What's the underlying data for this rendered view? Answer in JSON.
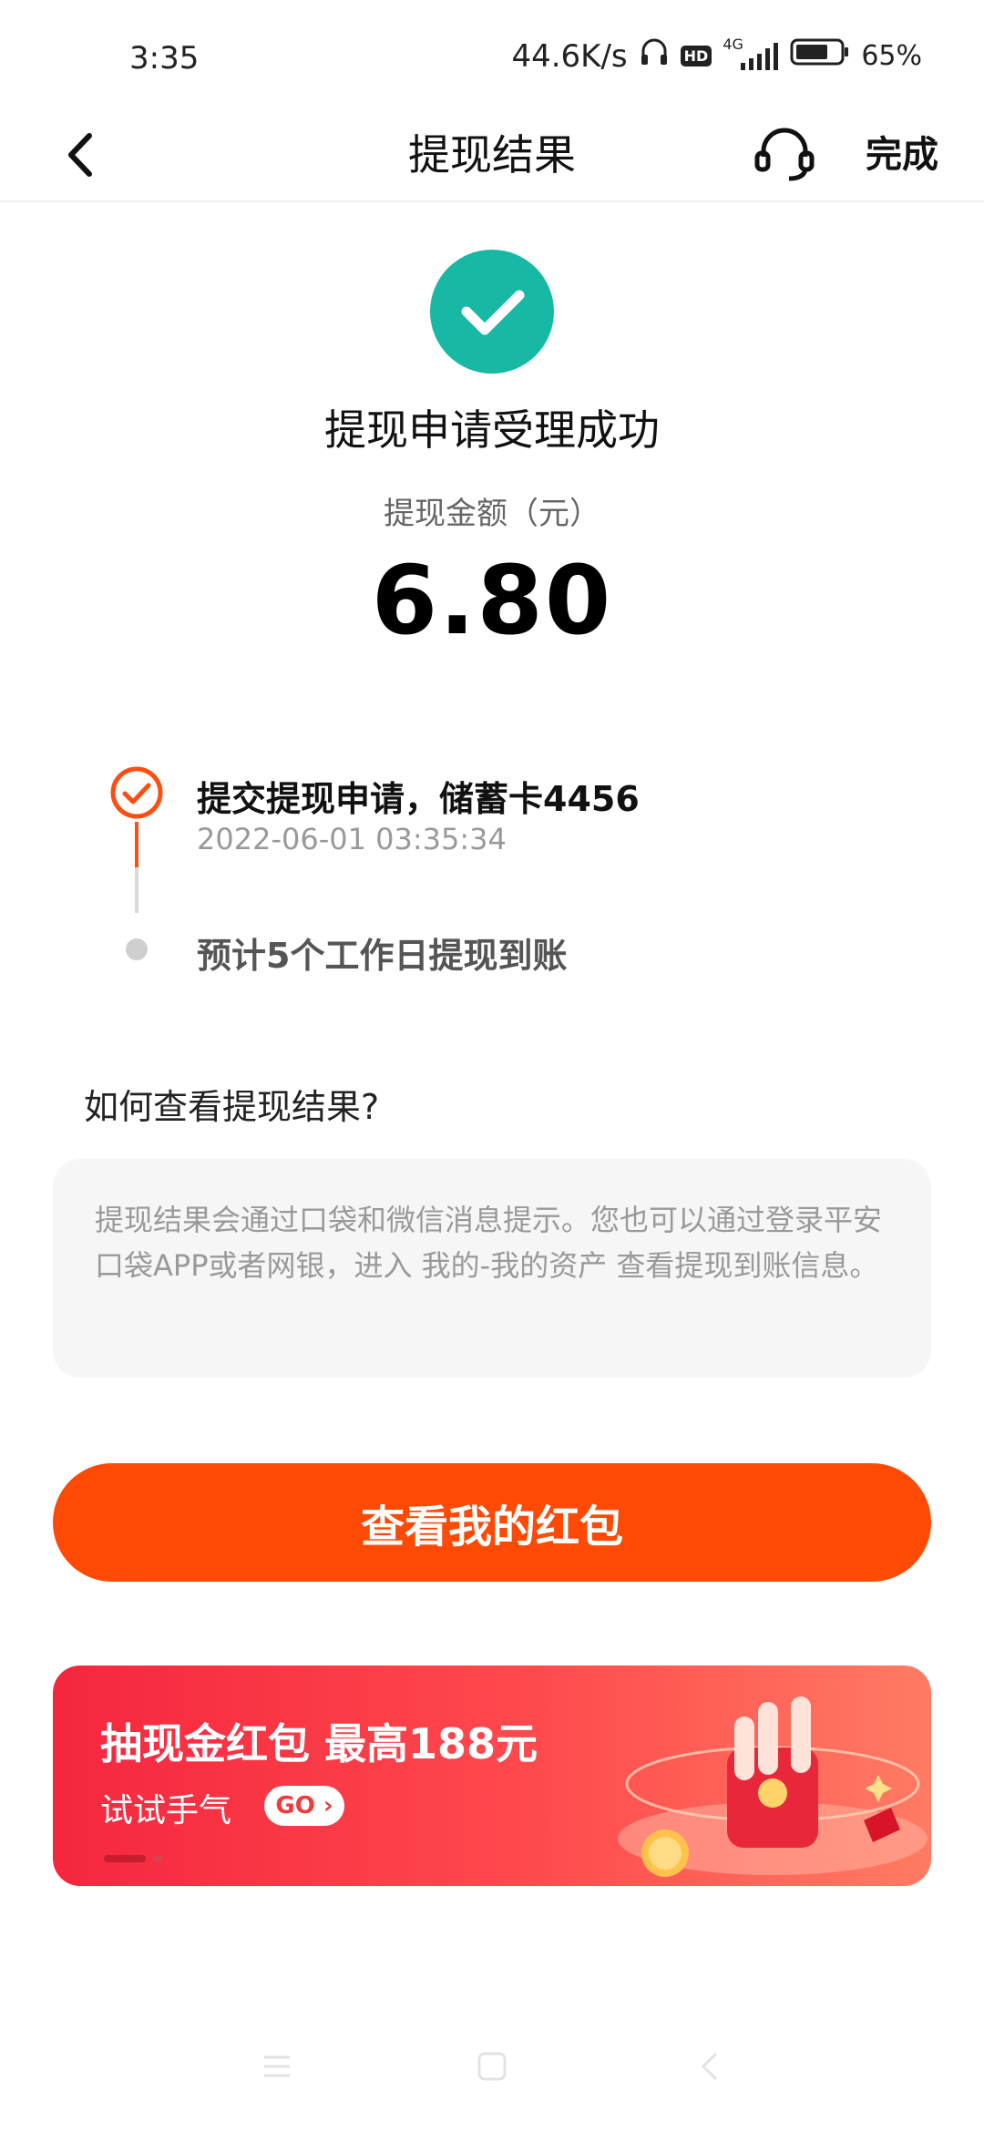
{
  "status_bar": {
    "time": "3:35",
    "network_speed": "44.6K/s",
    "hd_badge": "HD",
    "network_type": "4G",
    "battery_percent": "65%"
  },
  "nav": {
    "title": "提现结果",
    "done_label": "完成"
  },
  "result": {
    "title": "提现申请受理成功",
    "amount_label": "提现金额（元）",
    "amount": "6.80"
  },
  "timeline": {
    "steps": [
      {
        "title": "提交提现申请，储蓄卡4456",
        "time": "2022-06-01 03:35:34",
        "status": "done"
      },
      {
        "title": "预计5个工作日提现到账",
        "status": "pending"
      }
    ]
  },
  "faq": {
    "title": "如何查看提现结果?",
    "body": "提现结果会通过口袋和微信消息提示。您也可以通过登录平安口袋APP或者网银，进入 我的-我的资产 查看提现到账信息。"
  },
  "primary_button": {
    "label": "查看我的红包"
  },
  "banner": {
    "title": "抽现金红包  最高188元",
    "subtitle": "试试手气",
    "go_label": "GO ›"
  },
  "colors": {
    "success": "#17b8a4",
    "accent": "#ff4a06",
    "timeline_done": "#ff4e0f",
    "banner_red": "#f5263e"
  }
}
